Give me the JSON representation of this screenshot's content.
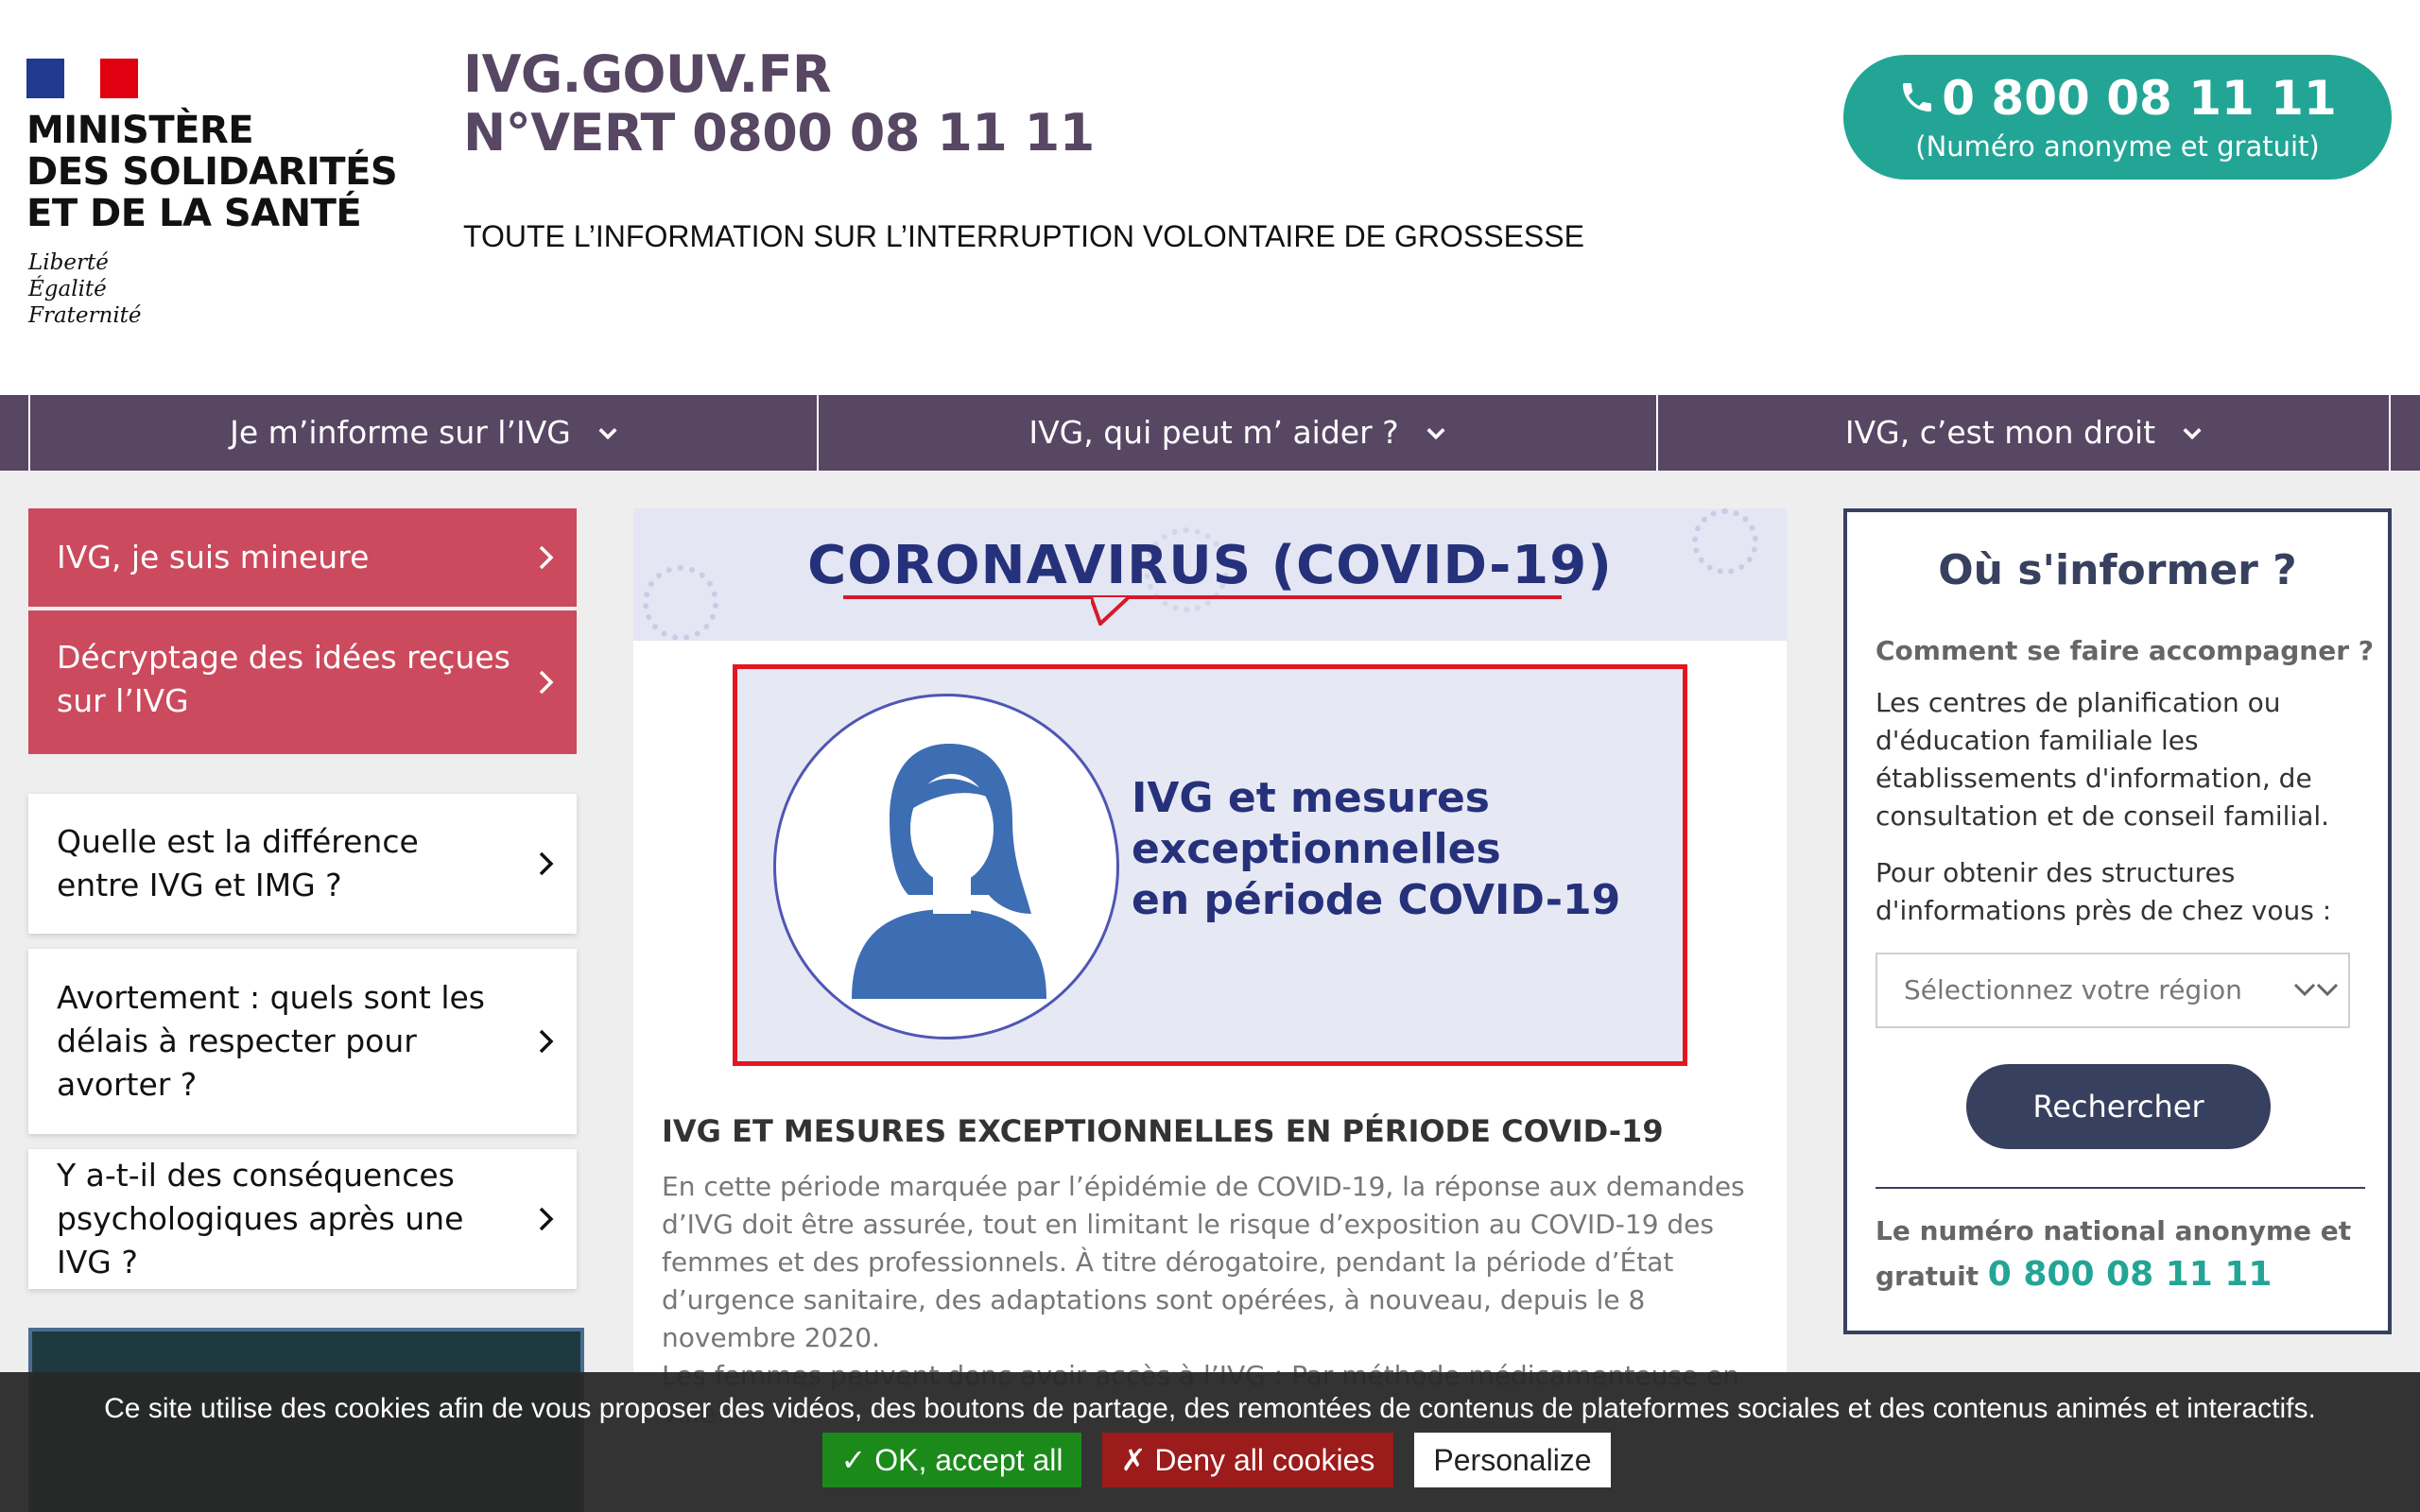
{
  "header": {
    "ministry_name": "MINISTÈRE\nDES SOLIDARITÉS\nET DE LA SANTÉ",
    "ministry_motto": "Liberté\nÉgalité\nFraternité",
    "site_title": "IVG.GOUV.FR\nN°VERT 0800 08 11 11",
    "tagline": "TOUTE L’INFORMATION SUR L’INTERRUPTION VOLONTAIRE DE GROSSESSE",
    "call_button": {
      "number": "0 800 08 11 11",
      "subtitle": "(Numéro anonyme et gratuit)",
      "icon": "phone-icon"
    }
  },
  "nav": {
    "items": [
      {
        "label": "Je m’informe sur l’IVG"
      },
      {
        "label": "IVG, qui peut m’ aider ?"
      },
      {
        "label": "IVG, c’est mon droit"
      }
    ]
  },
  "sidebar": {
    "red_items": [
      {
        "label": "IVG, je suis mineure"
      },
      {
        "label": "Décryptage des idées reçues sur l’IVG"
      }
    ],
    "faq_items": [
      {
        "label": "Quelle est la différence entre IVG et IMG ?"
      },
      {
        "label": "Avortement : quels sont les délais à respecter pour avorter ?"
      },
      {
        "label": "Y a-t-il des conséquences psychologiques après une IVG ?"
      }
    ]
  },
  "article": {
    "banner_title": "CORONAVIRUS (COVID-19)",
    "visual_text": "IVG et mesures\nexceptionnelles\nen période COVID-19",
    "title": "IVG ET MESURES EXCEPTIONNELLES EN PÉRIODE COVID-19",
    "body": "En cette période marquée par l’épidémie de COVID-19, la réponse aux demandes d’IVG doit être assurée, tout en limitant le risque d’exposition au COVID-19 des femmes et des professionnels. À titre dérogatoire, pendant la période d’État d’urgence sanitaire, des adaptations sont opérées, à nouveau, depuis le 8 novembre 2020.",
    "body_cut": "Les femmes peuvent donc avoir accès à l’IVG : Par méthode médicamenteuse en ville"
  },
  "info_panel": {
    "title": "Où s'informer ?",
    "subtitle": "Comment se faire accompagner ?",
    "paragraph1": "Les centres de planification ou d'éducation familiale les établissements d'information, de consultation et de conseil familial.",
    "paragraph2": "Pour obtenir des structures d'informations près de chez vous :",
    "select_placeholder": "Sélectionnez votre région",
    "search_button": "Rechercher",
    "national_label": "Le numéro national anonyme et gratuit",
    "national_number": "0 800 08 11 11"
  },
  "cookie_bar": {
    "text": "Ce site utilise des cookies afin de vous proposer des vidéos, des boutons de partage, des remontées de contenus de plateformes sociales et des contenus animés et interactifs.",
    "accept": "✓ OK, accept all",
    "deny": "✗ Deny all cookies",
    "personalize": "Personalize"
  },
  "colors": {
    "brand_purple": "#574763",
    "teal": "#23a596",
    "rose": "#cc4a5d",
    "navy": "#38405f"
  }
}
